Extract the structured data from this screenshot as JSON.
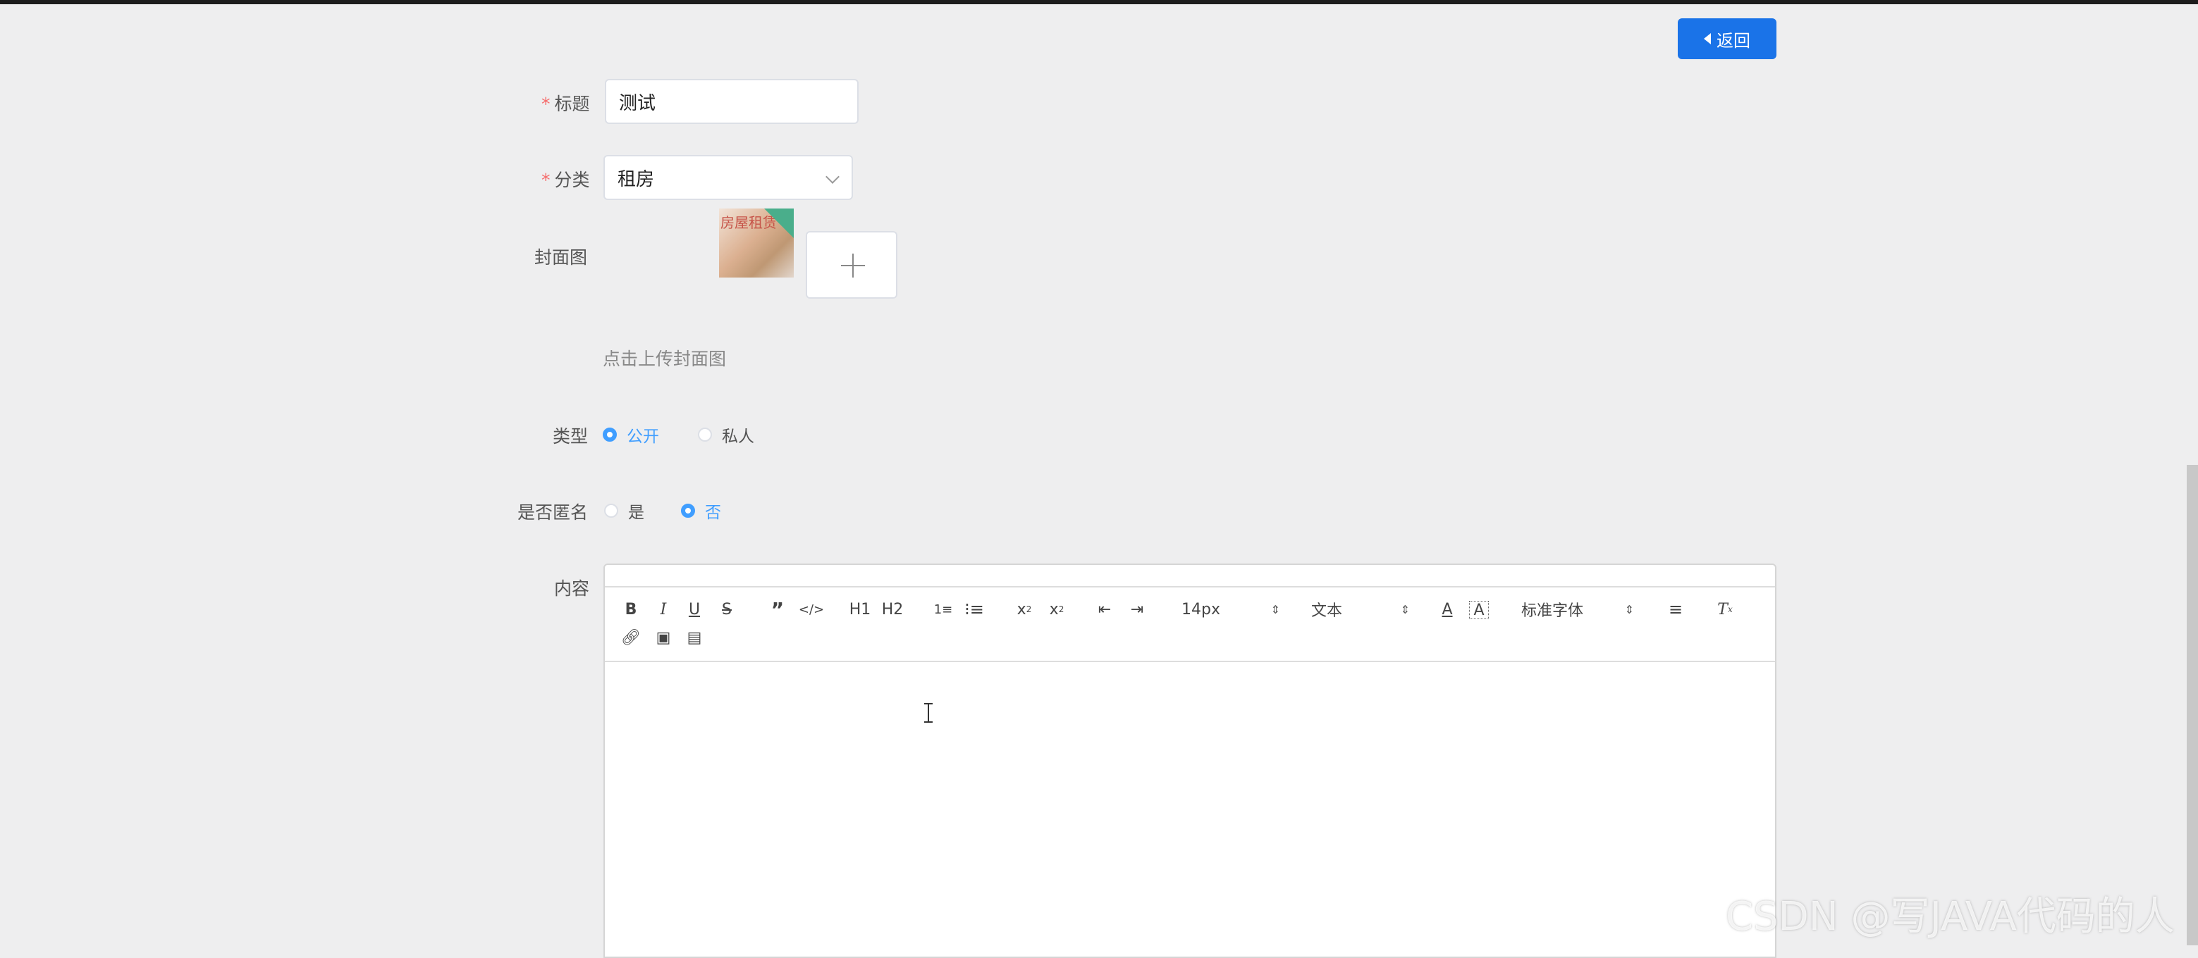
{
  "header": {
    "back_label": "返回"
  },
  "form": {
    "title": {
      "label": "标题",
      "value": "测试"
    },
    "category": {
      "label": "分类",
      "value": "租房"
    },
    "cover": {
      "label": "封面图",
      "thumb_text": "房屋租赁",
      "hint": "点击上传封面图"
    },
    "type": {
      "label": "类型",
      "options": [
        "公开",
        "私人"
      ],
      "selected": "公开"
    },
    "anonymous": {
      "label": "是否匿名",
      "options": [
        "是",
        "否"
      ],
      "selected": "否"
    },
    "content": {
      "label": "内容"
    }
  },
  "editor": {
    "font_size": "14px",
    "text_style": "文本",
    "font_family": "标准字体",
    "heading1": "H1",
    "heading2": "H2"
  },
  "watermark": "CSDN @写JAVA代码的人"
}
